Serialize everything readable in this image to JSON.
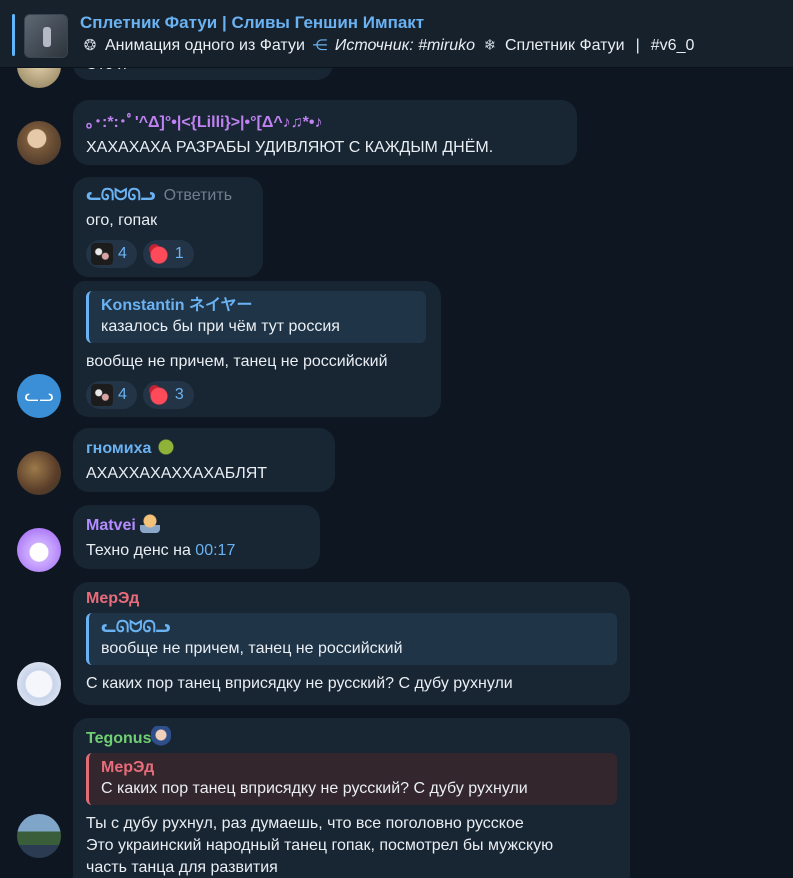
{
  "header": {
    "title": "Сплетник Фатуи | Сливы Геншин Импакт",
    "animation_label": "Анимация одного из Фатуи",
    "source_label": "Источник: #miruko",
    "channel_label": "Сплетник Фатуи",
    "separator": "|",
    "version_label": "#v6_0"
  },
  "messages": [
    {
      "text": "Это я"
    },
    {
      "name": "｡･:*:･ﾟ'^Δ]°•|<{Lilli}>|•°[Δ^♪♫*•♪",
      "name_color": "#c082f2",
      "text": "ХАХАХАХА РАЗРАБЫ УДИВЛЯЮТ С КАЖДЫМ ДНЁМ."
    },
    {
      "name": "ᓚᘏᗢᘏᓗ",
      "name_color": "#6ab2f2",
      "reply_label": "Ответить",
      "text": "ого, гопак",
      "reactions": [
        {
          "emoji": "cat",
          "count": "4"
        },
        {
          "emoji": "heart",
          "count": "1"
        }
      ]
    },
    {
      "quote_name": "Konstantin ネイヤー",
      "quote_text": "казалось бы при чём тут россия",
      "text": "вообще не причем, танец не российский",
      "reactions": [
        {
          "emoji": "cat",
          "count": "4"
        },
        {
          "emoji": "heart",
          "count": "3"
        }
      ],
      "avatar_letters": "ᓚᓗ"
    },
    {
      "name": "гномиха",
      "name_color": "#6ab2f2",
      "text": "АХАХХАХАХХАХАБЛЯТ"
    },
    {
      "name": "Matvei",
      "name_color": "#b38cff",
      "text_prefix": "Техно денс на ",
      "time_link": "00:17"
    },
    {
      "name": "МерЭд",
      "name_color": "#e96c7a",
      "quote_name": "ᓚᘏᗢᘏᓗ",
      "quote_text": "вообще не причем, танец не российский",
      "text": "С каких пор танец вприсядку не русский? С дубу рухнули"
    },
    {
      "name": "Tegonus",
      "name_color": "#6fcf72",
      "quote_name": "МерЭд",
      "quote_text": "С каких пор танец вприсядку не русский? С дубу рухнули",
      "text_lines": [
        "Ты с дубу рухнул, раз думаешь, что все поголовно русское",
        "Это украинский народный танец гопак, посмотрел бы мужскую",
        "часть танца для развития"
      ]
    }
  ],
  "colors": {
    "background": "#0e1621",
    "bubble": "#182533",
    "accent": "#6ab2f2"
  }
}
